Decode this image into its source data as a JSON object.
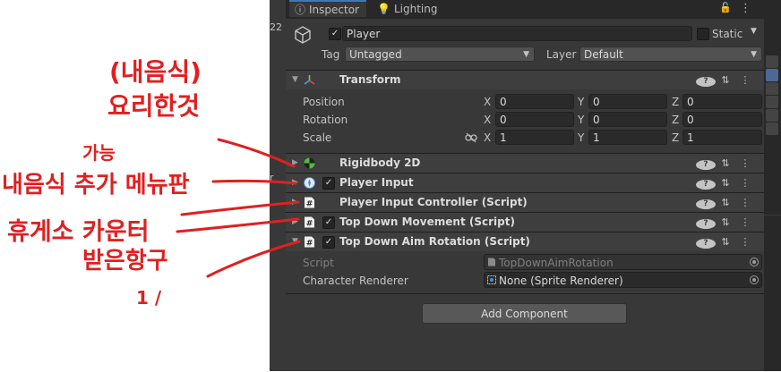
{
  "sliver": {
    "number": "22",
    "fragment": "r"
  },
  "tabs": [
    {
      "label": "Inspector",
      "icon": "info-icon",
      "active": true
    },
    {
      "label": "Lighting",
      "icon": "lightbulb-icon",
      "active": false
    }
  ],
  "header": {
    "object_name": "Player",
    "static_label": "Static",
    "tag_label": "Tag",
    "tag_value": "Untagged",
    "layer_label": "Layer",
    "layer_value": "Default"
  },
  "transform": {
    "title": "Transform",
    "rows": [
      {
        "label": "Position",
        "x": "0",
        "y": "0",
        "z": "0"
      },
      {
        "label": "Rotation",
        "x": "0",
        "y": "0",
        "z": "0"
      },
      {
        "label": "Scale",
        "x": "1",
        "y": "1",
        "z": "1"
      }
    ],
    "axis": {
      "x": "X",
      "y": "Y",
      "z": "Z"
    }
  },
  "components": [
    {
      "name": "Rigidbody 2D",
      "icon": "rigidbody-icon",
      "has_checkbox": false
    },
    {
      "name": "Player Input",
      "icon": "player-input-icon",
      "has_checkbox": true
    },
    {
      "name": "Player Input Controller (Script)",
      "icon": "script-icon",
      "has_checkbox": false
    },
    {
      "name": "Top Down Movement (Script)",
      "icon": "script-icon",
      "has_checkbox": true
    },
    {
      "name": "Top Down Aim Rotation (Script)",
      "icon": "script-icon",
      "has_checkbox": true
    }
  ],
  "aim_rotation": {
    "script_label": "Script",
    "script_value": "TopDownAimRotation",
    "renderer_label": "Character Renderer",
    "renderer_value": "None (Sprite Renderer)"
  },
  "add_component_label": "Add Component",
  "annotations": {
    "line1": "(내음식)",
    "line2": "요리한것",
    "line3": "가능",
    "line4": "내음식 추가 메뉴판",
    "line5": "휴게소 카운터",
    "line6": "받은항구",
    "line7": "1 /"
  },
  "colors": {
    "panel": "#383838",
    "header": "#3e3e3e",
    "accent": "#3a79bb",
    "annotation": "#e02020"
  }
}
